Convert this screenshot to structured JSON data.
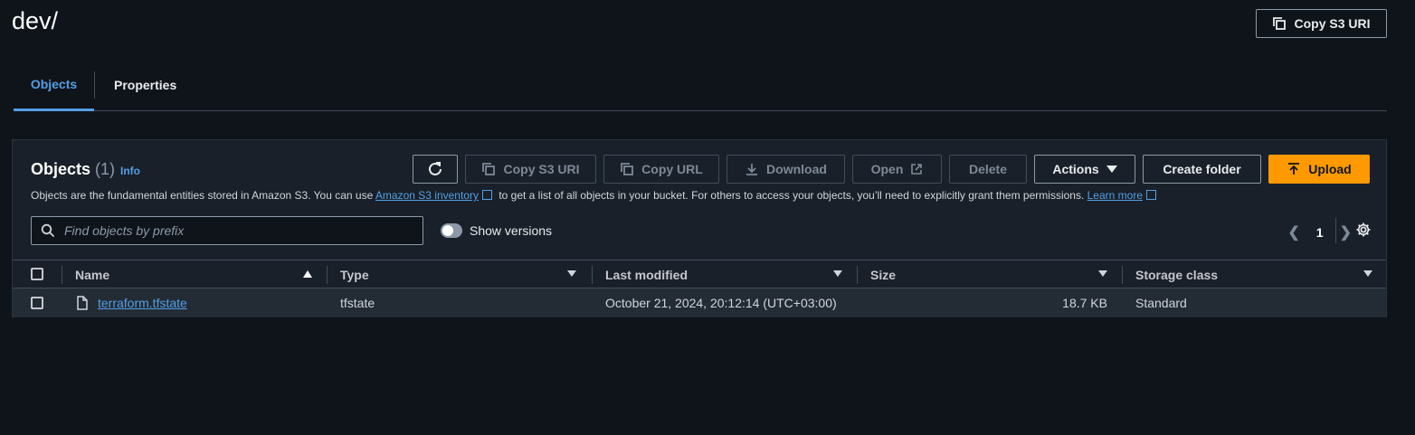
{
  "page": {
    "title": "dev/"
  },
  "header": {
    "copy_s3_uri_label": "Copy S3 URI"
  },
  "tabs": [
    {
      "label": "Objects",
      "active": true
    },
    {
      "label": "Properties",
      "active": false
    }
  ],
  "objects_panel": {
    "title": "Objects",
    "count": "(1)",
    "info_label": "Info",
    "description": {
      "part1": "Objects are the fundamental entities stored in Amazon S3. You can use ",
      "link1": "Amazon S3 inventory",
      "part2": " to get a list of all objects in your bucket. For others to access your objects, you’ll need to explicitly grant them permissions. ",
      "link2": "Learn more"
    },
    "toolbar": {
      "refresh_icon": "refresh-icon",
      "copy_s3_uri": "Copy S3 URI",
      "copy_url": "Copy URL",
      "download": "Download",
      "open": "Open",
      "delete": "Delete",
      "actions": "Actions",
      "create_folder": "Create folder",
      "upload": "Upload"
    },
    "search": {
      "placeholder": "Find objects by prefix",
      "value": ""
    },
    "show_versions": {
      "label": "Show versions",
      "enabled": false
    },
    "pagination": {
      "current_page": "1"
    },
    "columns": [
      "Name",
      "Type",
      "Last modified",
      "Size",
      "Storage class"
    ],
    "rows": [
      {
        "name": "terraform.tfstate",
        "type": "tfstate",
        "last_modified": "October 21, 2024, 20:12:14 (UTC+03:00)",
        "size": "18.7 KB",
        "storage_class": "Standard"
      }
    ]
  },
  "colors": {
    "accent": "#539fe5",
    "primary": "#ff9900",
    "background": "#0f141a",
    "panel": "#192029"
  }
}
